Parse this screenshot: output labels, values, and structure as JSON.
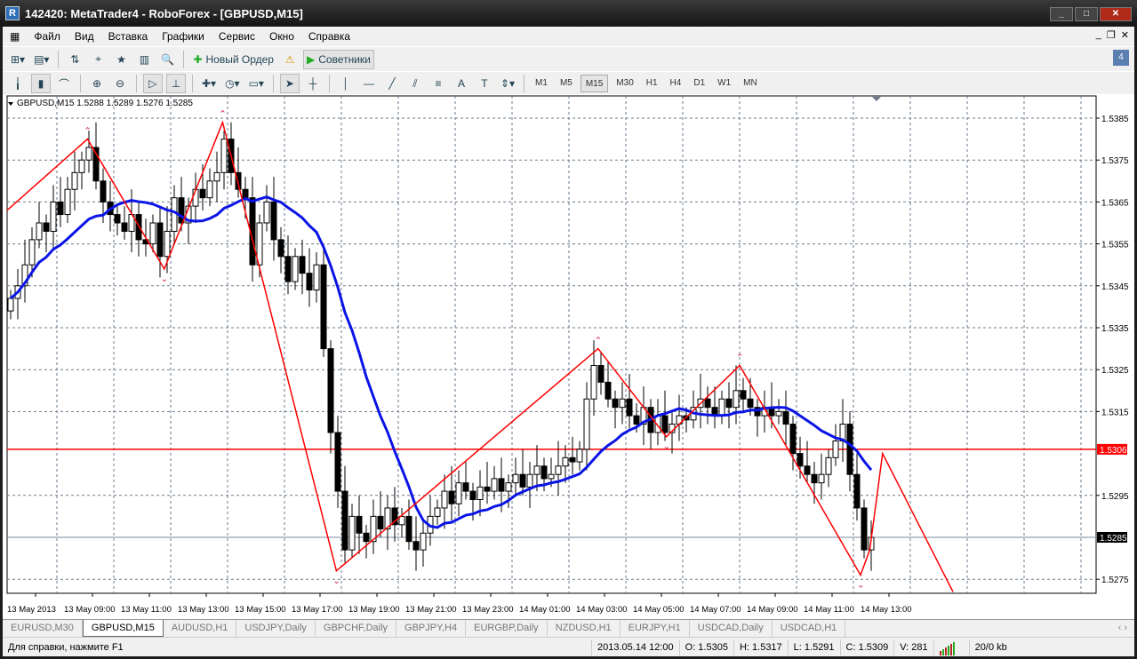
{
  "window": {
    "title": "142420: MetaTrader4 - RoboForex - [GBPUSD,M15]",
    "min": "_",
    "max": "□",
    "close": "✕"
  },
  "menu": [
    "Файл",
    "Вид",
    "Вставка",
    "Графики",
    "Сервис",
    "Окно",
    "Справка"
  ],
  "toolbar1": {
    "new_order": "Новый Ордер",
    "experts": "Советники",
    "notifications": "4"
  },
  "timeframes": [
    "M1",
    "M5",
    "M15",
    "M30",
    "H1",
    "H4",
    "D1",
    "W1",
    "MN"
  ],
  "selected_timeframe": "M15",
  "chart_header": "GBPUSD,M15  1.5288 1.5289 1.5276 1.5285",
  "chart_data": {
    "type": "candlestick",
    "symbol": "GBPUSD",
    "timeframe": "M15",
    "ylim": [
      1.527,
      1.539
    ],
    "y_ticks": [
      "1.5385",
      "1.5375",
      "1.5365",
      "1.5355",
      "1.5345",
      "1.5335",
      "1.5325",
      "1.5315",
      "1.5295",
      "1.5275"
    ],
    "x_ticks": [
      "13 May 2013",
      "13 May 09:00",
      "13 May 11:00",
      "13 May 13:00",
      "13 May 15:00",
      "13 May 17:00",
      "13 May 19:00",
      "13 May 21:00",
      "13 May 23:00",
      "14 May 01:00",
      "14 May 03:00",
      "14 May 05:00",
      "14 May 07:00",
      "14 May 09:00",
      "14 May 11:00",
      "14 May 13:00"
    ],
    "closes": [
      1.5342,
      1.5345,
      1.535,
      1.5356,
      1.536,
      1.5358,
      1.5365,
      1.5362,
      1.5368,
      1.5372,
      1.5375,
      1.5378,
      1.537,
      1.5365,
      1.5362,
      1.536,
      1.5358,
      1.5362,
      1.5356,
      1.5355,
      1.536,
      1.5352,
      1.5358,
      1.5366,
      1.536,
      1.5364,
      1.5368,
      1.5366,
      1.537,
      1.5372,
      1.538,
      1.5372,
      1.5368,
      1.5366,
      1.535,
      1.536,
      1.5365,
      1.5356,
      1.5352,
      1.5346,
      1.5352,
      1.5348,
      1.5344,
      1.535,
      1.533,
      1.531,
      1.5296,
      1.5282,
      1.529,
      1.5286,
      1.5284,
      1.529,
      1.5287,
      1.5292,
      1.5288,
      1.529,
      1.5284,
      1.5282,
      1.5286,
      1.529,
      1.5292,
      1.5296,
      1.5293,
      1.5298,
      1.5296,
      1.5294,
      1.5297,
      1.5296,
      1.5299,
      1.5296,
      1.5298,
      1.53,
      1.5297,
      1.53,
      1.5302,
      1.5299,
      1.53,
      1.5302,
      1.5304,
      1.5303,
      1.5306,
      1.5318,
      1.5326,
      1.5322,
      1.5318,
      1.5316,
      1.5318,
      1.5314,
      1.5312,
      1.5316,
      1.531,
      1.5314,
      1.531,
      1.5312,
      1.5314,
      1.5313,
      1.5316,
      1.5318,
      1.5316,
      1.5314,
      1.5318,
      1.5316,
      1.532,
      1.5318,
      1.5316,
      1.5314,
      1.5316,
      1.5314,
      1.5315,
      1.5312,
      1.5305,
      1.5302,
      1.53,
      1.5298,
      1.53,
      1.5304,
      1.5308,
      1.5312,
      1.53,
      1.5292,
      1.5282,
      1.5285
    ],
    "zigzag": [
      [
        -0.5,
        1.5363
      ],
      [
        10.8,
        1.538
      ],
      [
        21.6,
        1.5349
      ],
      [
        29.8,
        1.5384
      ],
      [
        45.8,
        1.5277
      ],
      [
        82.6,
        1.533
      ],
      [
        92.2,
        1.5309
      ],
      [
        102.5,
        1.5326
      ],
      [
        119.5,
        1.5276
      ],
      [
        120.8,
        1.5282
      ],
      [
        122.6,
        1.5305
      ],
      [
        132.5,
        1.5272
      ]
    ],
    "ma_period": 14,
    "lines": {
      "red_level": "1.5306",
      "bid": "1.5285"
    },
    "colors": {
      "ma": "#0a14e6",
      "zigzag": "#ff0000",
      "bid_bg": "#000000",
      "level_bg": "#ff0000"
    }
  },
  "tabs": [
    "EURUSD,M30",
    "GBPUSD,M15",
    "AUDUSD,H1",
    "USDJPY,Daily",
    "GBPCHF,Daily",
    "GBPJPY,H4",
    "EURGBP,Daily",
    "NZDUSD,H1",
    "EURJPY,H1",
    "USDCAD,Daily",
    "USDCAD,H1"
  ],
  "status": {
    "help": "Для справки, нажмите F1",
    "time": "2013.05.14 12:00",
    "open": "O: 1.5305",
    "high": "H: 1.5317",
    "low": "L: 1.5291",
    "close": "C: 1.5309",
    "volume": "V: 281",
    "traffic": "20/0 kb"
  }
}
